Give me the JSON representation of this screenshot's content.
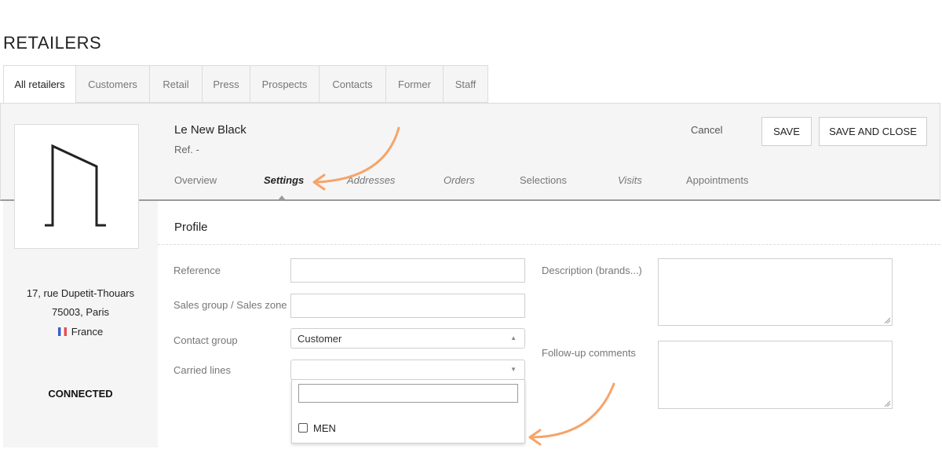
{
  "page": {
    "title": "RETAILERS"
  },
  "tabs": [
    {
      "label": "All retailers"
    },
    {
      "label": "Customers"
    },
    {
      "label": "Retail"
    },
    {
      "label": "Press"
    },
    {
      "label": "Prospects"
    },
    {
      "label": "Contacts"
    },
    {
      "label": "Former"
    },
    {
      "label": "Staff"
    }
  ],
  "retailer": {
    "name": "Le New Black",
    "ref": "Ref. -"
  },
  "header_actions": {
    "cancel": "Cancel",
    "save": "SAVE",
    "save_close": "SAVE AND CLOSE"
  },
  "subnav": [
    {
      "label": "Overview"
    },
    {
      "label": "Settings"
    },
    {
      "label": "Addresses"
    },
    {
      "label": "Orders"
    },
    {
      "label": "Selections"
    },
    {
      "label": "Visits"
    },
    {
      "label": "Appointments"
    }
  ],
  "sidebar": {
    "address_line1": "17, rue Dupetit-Thouars",
    "address_line2": "75003, Paris",
    "country": "France",
    "status": "CONNECTED"
  },
  "profile": {
    "title": "Profile",
    "reference_label": "Reference",
    "reference_value": "",
    "sales_group_label": "Sales group / Sales zone",
    "sales_group_value": "",
    "contact_group_label": "Contact group",
    "contact_group_value": "Customer",
    "carried_lines_label": "Carried lines",
    "carried_lines_value": "",
    "carried_lines_search": "",
    "carried_lines_options": [
      {
        "label": "MEN",
        "checked": false
      }
    ],
    "description_label": "Description (brands...)",
    "followup_label": "Follow-up comments"
  },
  "colors": {
    "annotation_arrow": "#f5a46b",
    "band_bg": "#f5f5f5"
  },
  "icons": {
    "logo": "logo-mark",
    "select_up": "chevron-up-icon",
    "select_down": "chevron-down-icon"
  }
}
